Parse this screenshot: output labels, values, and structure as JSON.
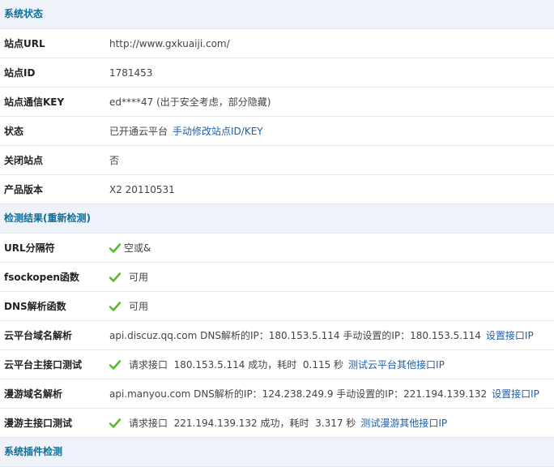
{
  "sections": {
    "status_title": "系统状态",
    "check_title": "检测结果(重新检测)",
    "plugin_title": "系统插件检测"
  },
  "status": {
    "site_url": {
      "label": "站点URL",
      "value": "http://www.gxkuaiji.com/"
    },
    "site_id": {
      "label": "站点ID",
      "value": "1781453"
    },
    "site_key": {
      "label": "站点通信KEY",
      "value": "ed****47 (出于安全考虑，部分隐藏)"
    },
    "state": {
      "label": "状态",
      "value": "已开通云平台",
      "link": "手动修改站点ID/KEY"
    },
    "closed": {
      "label": "关闭站点",
      "value": "否"
    },
    "version": {
      "label": "产品版本",
      "value": "X2 20110531"
    }
  },
  "checks": {
    "url_sep": {
      "label": "URL分隔符",
      "value": "空或&"
    },
    "fsockopen": {
      "label": "fsockopen函数",
      "value": "可用"
    },
    "dns_func": {
      "label": "DNS解析函数",
      "value": "可用"
    },
    "cloud_dns": {
      "label": "云平台域名解析",
      "value": "api.discuz.qq.com DNS解析的IP：180.153.5.114 手动设置的IP：180.153.5.114",
      "link": "设置接口IP"
    },
    "cloud_api": {
      "label": "云平台主接口测试",
      "value": "请求接口  180.153.5.114 成功，耗时  0.115 秒",
      "link": "测试云平台其他接口IP"
    },
    "manyou_dns": {
      "label": "漫游域名解析",
      "value": "api.manyou.com DNS解析的IP：124.238.249.9 手动设置的IP：221.194.139.132",
      "link": "设置接口IP"
    },
    "manyou_api": {
      "label": "漫游主接口测试",
      "value": "请求接口  221.194.139.132 成功，耗时  3.317 秒",
      "link": "测试漫游其他接口IP"
    }
  },
  "colors": {
    "accent": "#0a6f9a",
    "link": "#1f5fa8",
    "check": "#5cb82d",
    "section_bg": "#eef3fa"
  },
  "icons": {
    "check": "check-icon"
  }
}
